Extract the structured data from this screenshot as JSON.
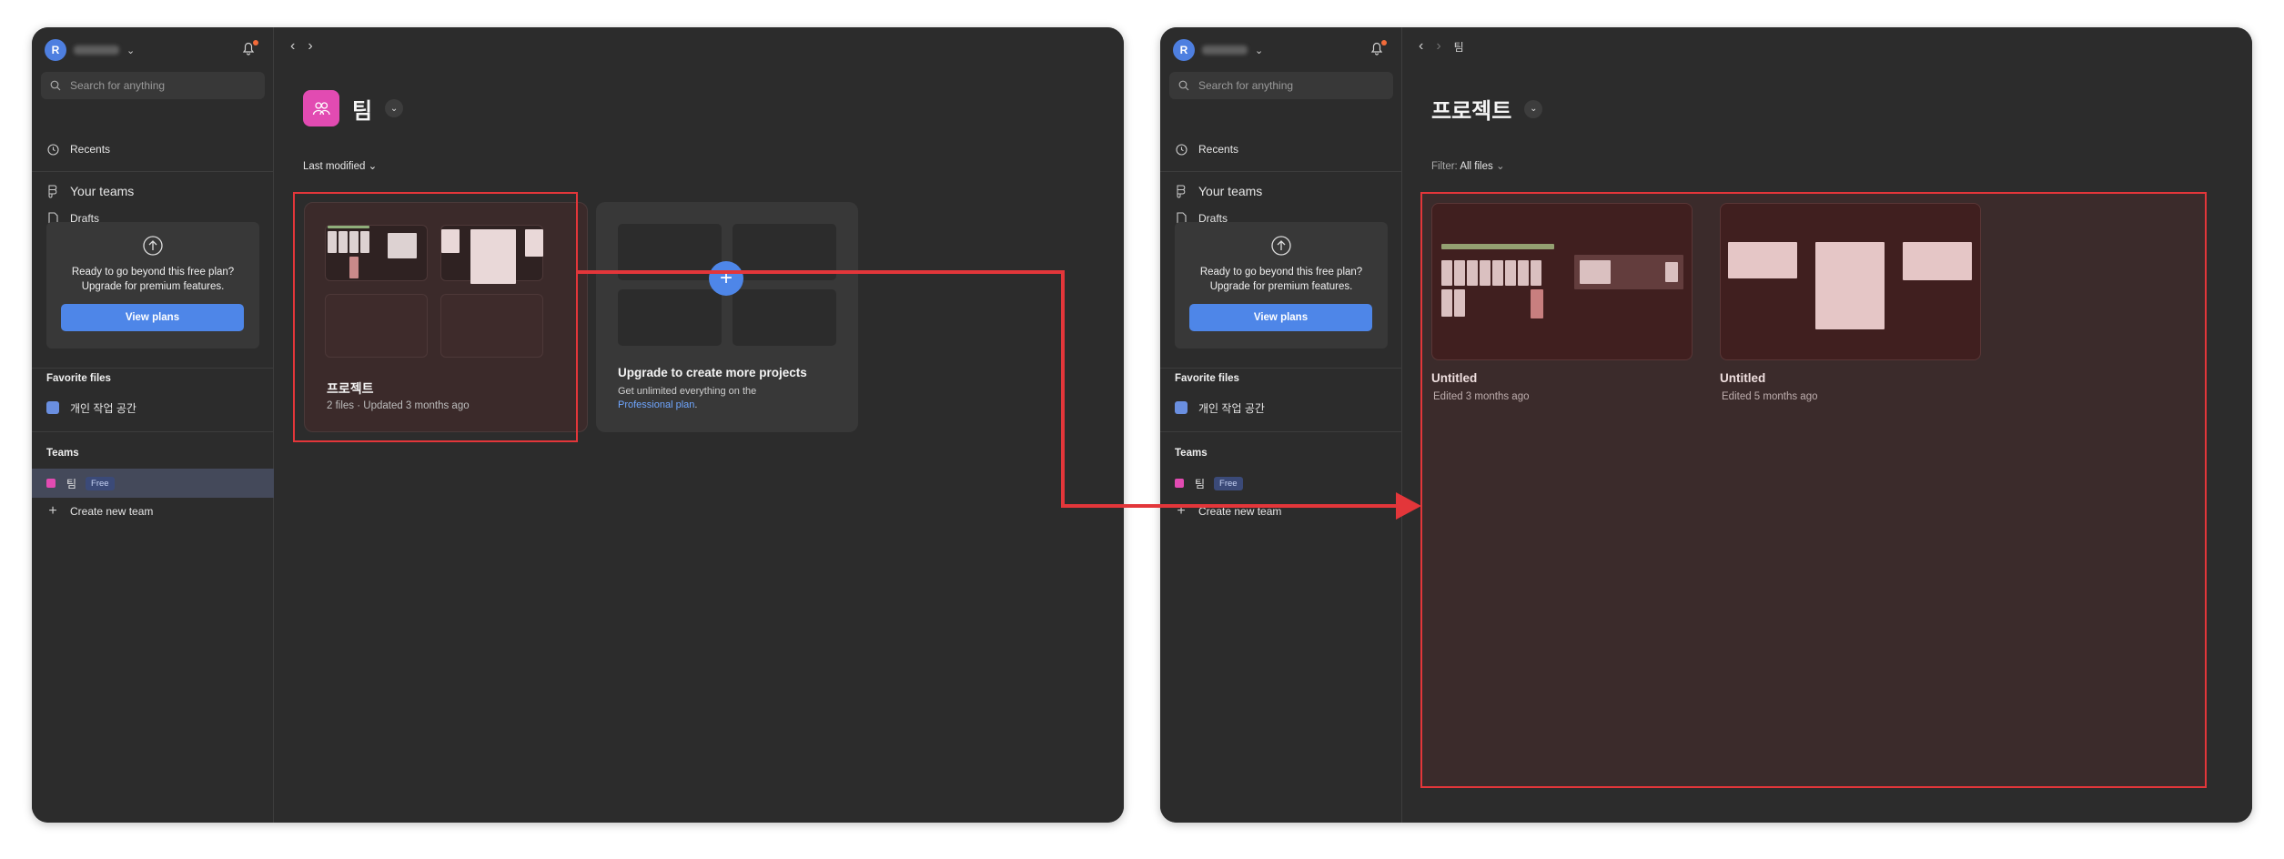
{
  "sidebar": {
    "avatar_letter": "R",
    "search_placeholder": "Search for anything",
    "recents": "Recents",
    "your_teams": "Your teams",
    "drafts": "Drafts",
    "promo_line1": "Ready to go beyond this free plan?",
    "promo_line2": "Upgrade for premium features.",
    "view_plans": "View plans",
    "favorite_files_heading": "Favorite files",
    "favorite_file": "개인 작업 공간",
    "teams_heading": "Teams",
    "team_name": "팀",
    "team_badge": "Free",
    "create_team": "Create new team"
  },
  "left": {
    "team_title": "팀",
    "sort_label": "Last modified",
    "project": {
      "name": "프로젝트",
      "meta": "2 files · Updated 3 months ago"
    },
    "upgrade": {
      "title": "Upgrade to create more projects",
      "line": "Get unlimited everything on the",
      "link": "Professional plan",
      "suffix": "."
    }
  },
  "right": {
    "breadcrumb": "팀",
    "project_title": "프로젝트",
    "filter_label": "Filter:",
    "filter_value": "All files",
    "files": [
      {
        "name": "Untitled",
        "meta": "Edited 3 months ago"
      },
      {
        "name": "Untitled",
        "meta": "Edited 5 months ago"
      }
    ]
  },
  "colors": {
    "accent": "#4e86e8",
    "highlight": "#e3363a",
    "team": "#e24bb2"
  }
}
